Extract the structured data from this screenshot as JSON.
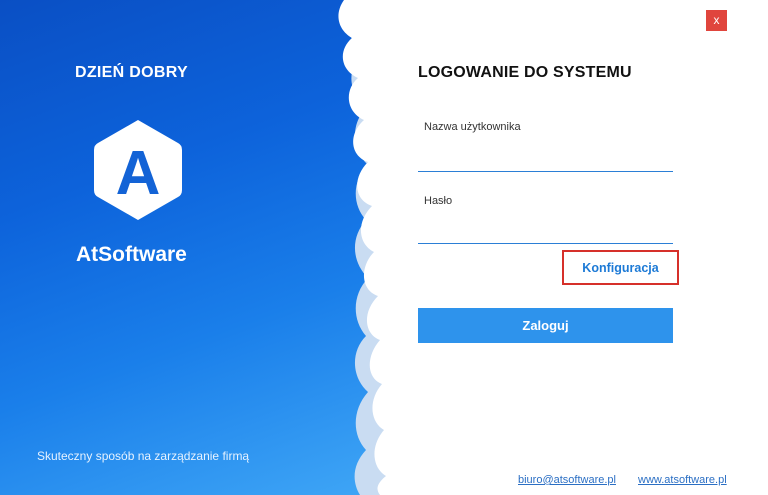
{
  "left_panel": {
    "greeting": "DZIEŃ DOBRY",
    "logo_letter": "A",
    "brand": "AtSoftware",
    "tagline": "Skuteczny sposób na zarządzanie firmą"
  },
  "window": {
    "close_label": "x"
  },
  "login": {
    "title": "LOGOWANIE DO SYSTEMU",
    "username_label": "Nazwa użytkownika",
    "username_value": "",
    "password_label": "Hasło",
    "password_value": "",
    "config_link": "Konfiguracja",
    "submit_label": "Zaloguj"
  },
  "footer": {
    "email": "biuro@atsoftware.pl",
    "website": "www.atsoftware.pl"
  },
  "colors": {
    "brand_blue": "#0d63db",
    "button_blue": "#2e93ec",
    "close_red": "#e0453d",
    "highlight_red": "#d6302a"
  }
}
